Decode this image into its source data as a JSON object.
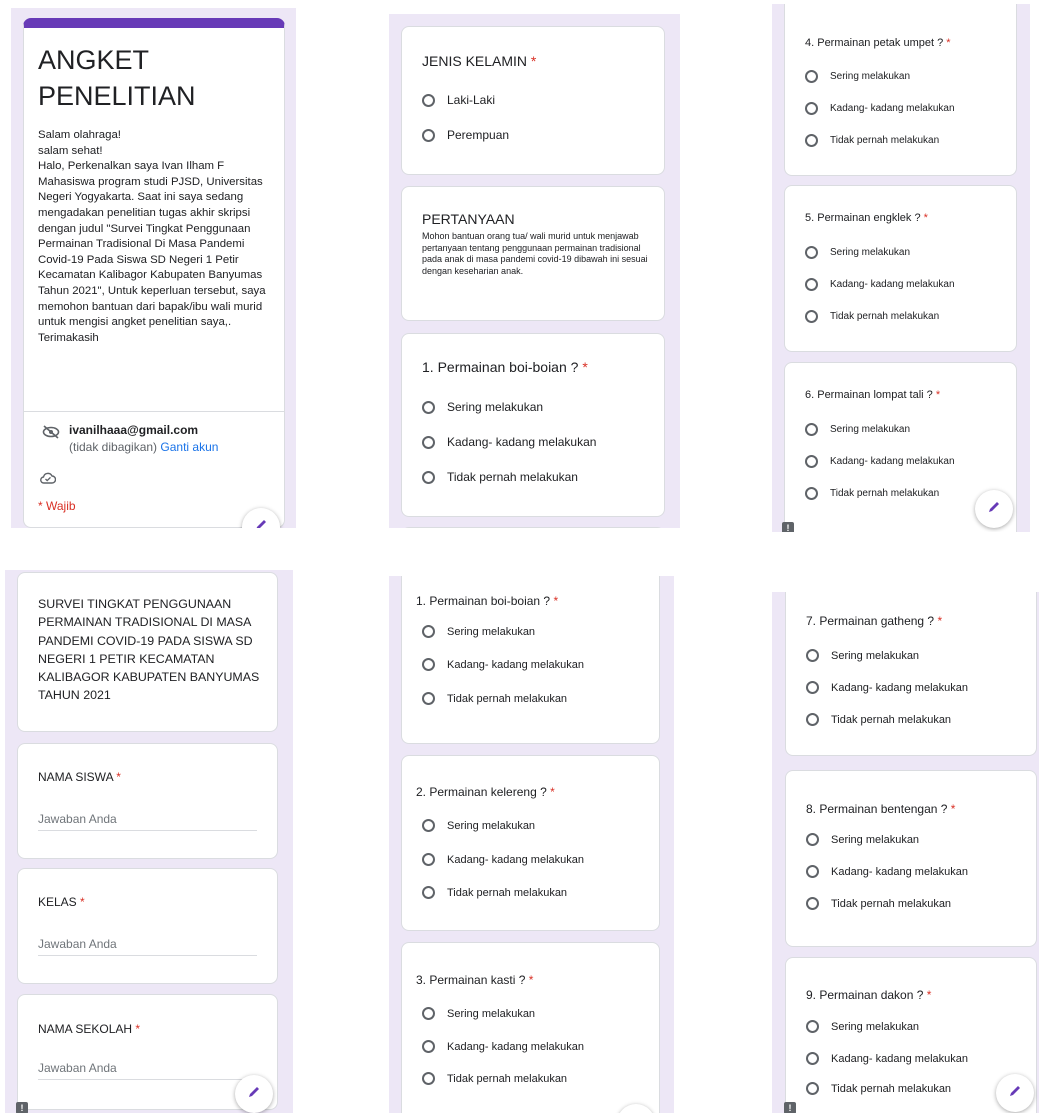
{
  "colors": {
    "accent": "#673ab7",
    "required": "#d93025",
    "link": "#1a73e8",
    "background": "#ede7f6"
  },
  "header_card": {
    "title": "ANGKET PENELITIAN",
    "description": [
      "Salam olahraga!",
      "salam sehat!",
      "Halo, Perkenalkan saya Ivan Ilham F Mahasiswa program studi PJSD, Universitas Negeri Yogyakarta. Saat ini saya sedang mengadakan penelitian tugas akhir skripsi dengan judul \"Survei Tingkat Penggunaan Permainan Tradisional Di Masa Pandemi Covid-19 Pada Siswa SD Negeri 1 Petir Kecamatan Kalibagor Kabupaten Banyumas Tahun 2021\", Untuk keperluan tersebut, saya memohon bantuan dari bapak/ibu wali murid untuk mengisi angket penelitian saya,.",
      "Terimakasih"
    ],
    "email": "ivanilhaaa@gmail.com",
    "not_shared": "(tidak dibagikan)",
    "switch_account": "Ganti akun",
    "required_note": "* Wajib",
    "icons": [
      "eye-off-icon",
      "cloud-check-icon",
      "pencil-icon"
    ]
  },
  "section_title": "SURVEI TINGKAT PENGGUNAAN PERMAINAN TRADISIONAL DI MASA PANDEMI COVID-19 PADA SISWA SD NEGERI 1 PETIR KECAMATAN KALIBAGOR KABUPATEN BANYUMAS TAHUN 2021",
  "text_fields": [
    {
      "label": "NAMA SISWA",
      "placeholder": "Jawaban Anda"
    },
    {
      "label": "KELAS",
      "placeholder": "Jawaban Anda"
    },
    {
      "label": "NAMA SEKOLAH",
      "placeholder": "Jawaban Anda"
    }
  ],
  "gender": {
    "label": "JENIS KELAMIN",
    "options": [
      "Laki-Laki",
      "Perempuan"
    ]
  },
  "pertanyaan": {
    "title": "PERTANYAAN",
    "text": "Mohon bantuan orang tua/ wali murid untuk menjawab pertanyaan tentang penggunaan permainan tradisional pada anak di masa pandemi covid-19 dibawah ini sesuai dengan keseharian anak."
  },
  "options": [
    "Sering melakukan",
    "Kadang- kadang melakukan",
    "Tidak pernah melakukan"
  ],
  "questions": [
    "1. Permainan boi-boian ?",
    "2. Permainan kelereng ?",
    "3. Permainan kasti ?",
    "4. Permainan petak umpet ?",
    "5. Permainan engklek ?",
    "6. Permainan lompat tali ?",
    "7. Permainan gatheng ?",
    "8. Permainan bentengan ?",
    "9. Permainan dakon ?"
  ],
  "required_mark": "*",
  "flag_glyph": "!"
}
